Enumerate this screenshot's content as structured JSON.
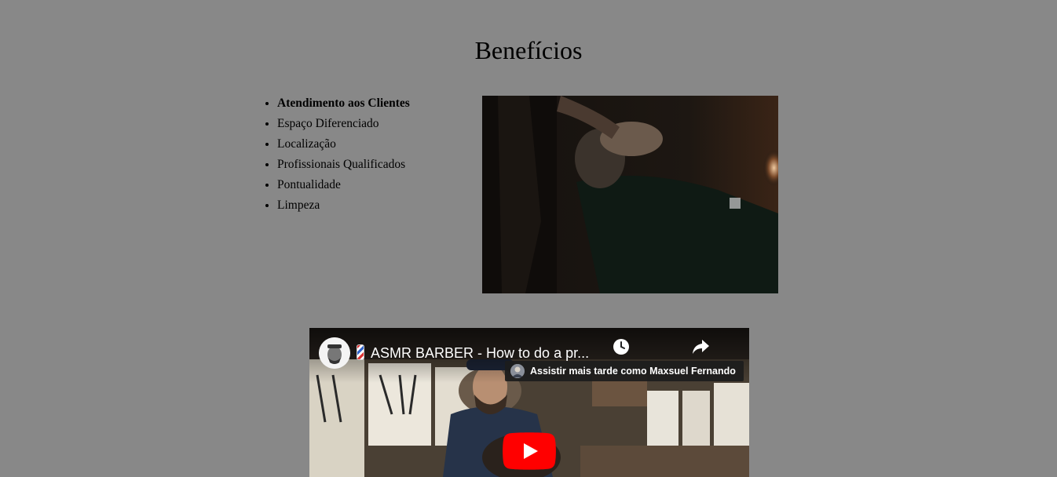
{
  "section": {
    "title": "Benefícios"
  },
  "benefits": {
    "items": [
      {
        "label": "Atendimento aos Clientes",
        "bold": true
      },
      {
        "label": "Espaço Diferenciado",
        "bold": false
      },
      {
        "label": "Localização",
        "bold": false
      },
      {
        "label": "Profissionais Qualificados",
        "bold": false
      },
      {
        "label": "Pontualidade",
        "bold": false
      },
      {
        "label": "Limpeza",
        "bold": false
      }
    ]
  },
  "video": {
    "title": "ASMR BARBER - How to do a pr...",
    "watch_later_tooltip": "Assistir mais tarde como Maxsuel Fernando",
    "icons": [
      "channel-avatar",
      "barber-pole-icon",
      "clock-icon",
      "share-icon",
      "play-icon"
    ]
  },
  "colors": {
    "background": "#888888",
    "youtube_red": "#ff0000"
  }
}
